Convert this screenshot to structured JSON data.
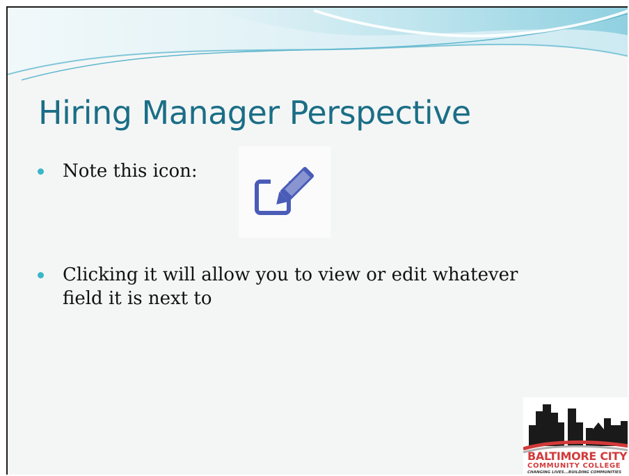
{
  "slide": {
    "title": "Hiring Manager Perspective",
    "bullets": [
      {
        "text": "Note this icon:"
      },
      {
        "text_line1": "Clicking it will allow you to view or edit whatever",
        "text_line2": "field it is next to"
      }
    ],
    "edit_icon": "edit-pencil-icon",
    "logo": {
      "line1": "BALTIMORE CITY",
      "line2": "COMMUNITY COLLEGE",
      "line3": "CHANGING LIVES...BUILDING COMMUNITIES"
    }
  },
  "colors": {
    "title": "#1b6e86",
    "bullet_dot": "#3cb6c9",
    "logo_red": "#d23a3a",
    "wave_light": "#cdeaf2",
    "wave_mid": "#8fd0e0"
  }
}
